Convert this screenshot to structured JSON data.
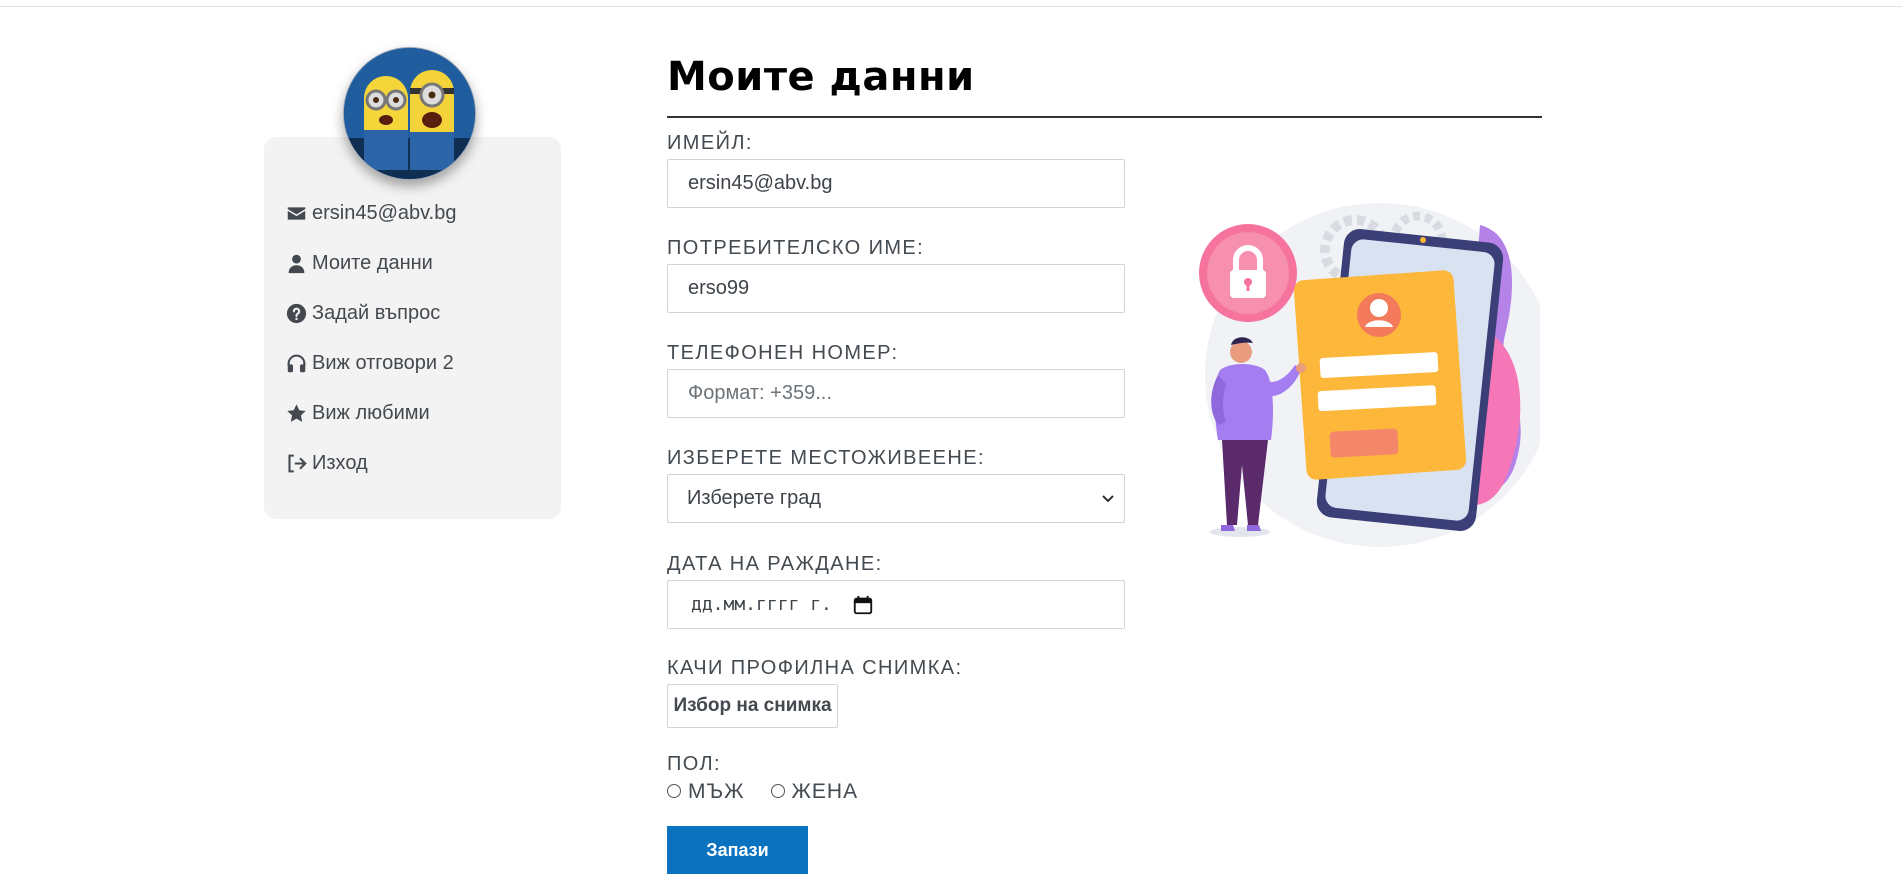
{
  "sidebar": {
    "items": [
      {
        "label": "ersin45@abv.bg",
        "icon": "envelope-icon"
      },
      {
        "label": "Моите данни",
        "icon": "user-icon"
      },
      {
        "label": "Задай въпрос",
        "icon": "question-circle-icon"
      },
      {
        "label": "Виж отговори 2",
        "icon": "headphones-icon"
      },
      {
        "label": "Виж любими",
        "icon": "star-icon"
      },
      {
        "label": "Изход",
        "icon": "sign-out-icon"
      }
    ]
  },
  "main": {
    "title": "Моите данни",
    "email": {
      "label": "ИМЕЙЛ:",
      "value": "ersin45@abv.bg"
    },
    "username": {
      "label": "ПОТРЕБИТЕЛСКО ИМЕ:",
      "value": "erso99"
    },
    "phone": {
      "label": "ТЕЛЕФОНЕН НОМЕР:",
      "value": "",
      "placeholder": "Формат: +359..."
    },
    "city": {
      "label": "ИЗБЕРЕТЕ МЕСТОЖИВЕЕНЕ:",
      "selected": "Изберете град"
    },
    "birthdate": {
      "label": "ДАТА НА РАЖДАНЕ:",
      "placeholder": "дд.мм.гггг г."
    },
    "photo": {
      "label": "КАЧИ ПРОФИЛНА СНИМКА:",
      "button": "Избор на снимка"
    },
    "gender": {
      "label": "ПОЛ:",
      "options": [
        "МЪЖ",
        "ЖЕНА"
      ]
    },
    "save_label": "Запази"
  },
  "colors": {
    "primary_button": "#0a72be",
    "sidebar_bg": "#f3f3f3",
    "text": "#434a50"
  }
}
